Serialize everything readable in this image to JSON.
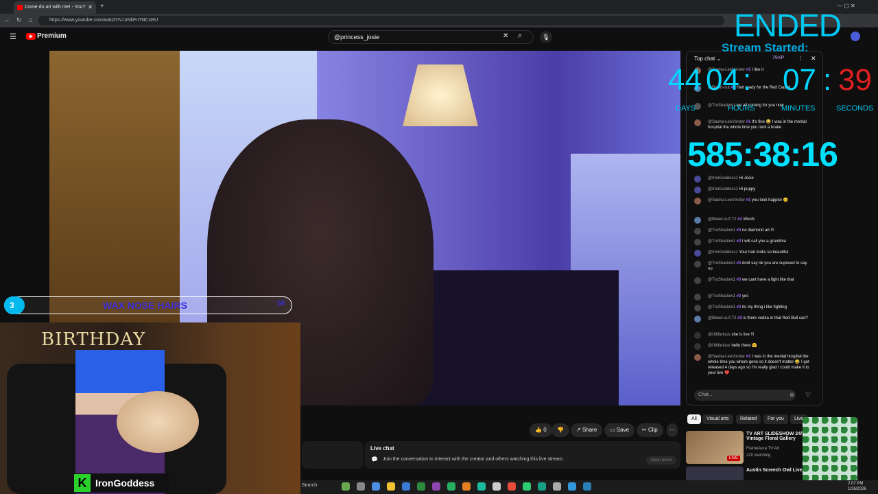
{
  "browser": {
    "tab_title": "Come do art with me! - YouT",
    "url": "https://www.youtube.com/watch?v=nNkFnTNCsRU"
  },
  "youtube": {
    "logo_text": "Premium",
    "search_value": "@princess_josie",
    "actions": {
      "like_count": "0",
      "share": "Share",
      "save": "Save",
      "clip": "Clip"
    },
    "live_chat_panel": {
      "title": "Live chat",
      "description": "Join the conversation to interact with the creator and others watching this live stream.",
      "button": "Open panel"
    }
  },
  "overlay_bar": {
    "number": "3",
    "text": "WAX NOSE HAIRS",
    "goal": "50"
  },
  "webcam": {
    "name": "IronGoddess",
    "banner": "BIRTHDAY"
  },
  "timer": {
    "ended": "ENDED",
    "stream_started": "Stream Started:",
    "days": "44",
    "hours": "04",
    "minutes": "07",
    "seconds": "39",
    "sep": ":",
    "days_label": "DAYS",
    "hours_label": "HOURS",
    "minutes_label": "MINUTES",
    "seconds_label": "SECONDS",
    "elapsed": "585:38:16"
  },
  "chat": {
    "header": "Top chat",
    "xp": "75XP",
    "input_placeholder": "Chat...",
    "messages": [
      {
        "user": "@Sasha-LeeVorster",
        "badge": "#1",
        "text": "I like it"
      },
      {
        "user": "@Bleed-out",
        "badge": "#1",
        "text": "Hair ready for the Red Carpet"
      },
      {
        "user": "@TruShadow1",
        "badge": "",
        "text": "we all coming for you now"
      },
      {
        "user": "@Sasha-LeeVorster",
        "badge": "#1",
        "text": "It's fine 😂 I was in the mental hospital the whole time you took a brake"
      },
      {
        "user": "@IronGoddess1",
        "badge": "",
        "text": "Hi Josie"
      },
      {
        "user": "@IronGoddess1",
        "badge": "",
        "text": "Hi puppy"
      },
      {
        "user": "@Sasha-LeeVorster",
        "badge": "#1",
        "text": "you look happier 😊"
      },
      {
        "user": "@Bleed-ouT.72",
        "badge": "#2",
        "text": "Woofs"
      },
      {
        "user": "@TruShadow1",
        "badge": "#3",
        "text": "no diamond art !!!"
      },
      {
        "user": "@TruShadow1",
        "badge": "#3",
        "text": "I will call you a grandma"
      },
      {
        "user": "@IronGoddess1",
        "badge": "",
        "text": "Your hair looks so beautiful"
      },
      {
        "user": "@TruShadow1",
        "badge": "#3",
        "text": "dont say ok you are suposed to say no"
      },
      {
        "user": "@TruShadow1",
        "badge": "#3",
        "text": "we cant have a fight like that"
      },
      {
        "user": "@TruShadow1",
        "badge": "#3",
        "text": "yes"
      },
      {
        "user": "@TruShadow1",
        "badge": "#3",
        "text": "its my thing i like fighting"
      },
      {
        "user": "@Bleed-ouT.72",
        "badge": "#2",
        "text": "is there vodka in that Red Bull can?"
      },
      {
        "user": "@Ultifarious",
        "badge": "",
        "text": "she is live !!!"
      },
      {
        "user": "@Ultifarious",
        "badge": "",
        "text": "hello there 🤗"
      },
      {
        "user": "@Sasha-LeeVorster",
        "badge": "#1",
        "text": "I was in the mental hospital the whole time you where gone so it doesn't matter 😂 I got released 4 days ago so I'm really glad I could make it to your live ❤️"
      }
    ]
  },
  "recommendations": {
    "chips": [
      "All",
      "Visual arts",
      "Related",
      "For you",
      "Live"
    ],
    "items": [
      {
        "title": "TV ART SLIDESHOW 24/7 Vintage Floral Gallery",
        "channel": "FrameAura TV Art",
        "meta": "220 watching",
        "badge": "LIVE"
      },
      {
        "title": "Austin Screech Owl Live S",
        "channel": "",
        "meta": "",
        "badge": ""
      }
    ]
  },
  "taskbar": {
    "search": "Search",
    "time": "2:07 PM",
    "date": "1/26/2026"
  }
}
